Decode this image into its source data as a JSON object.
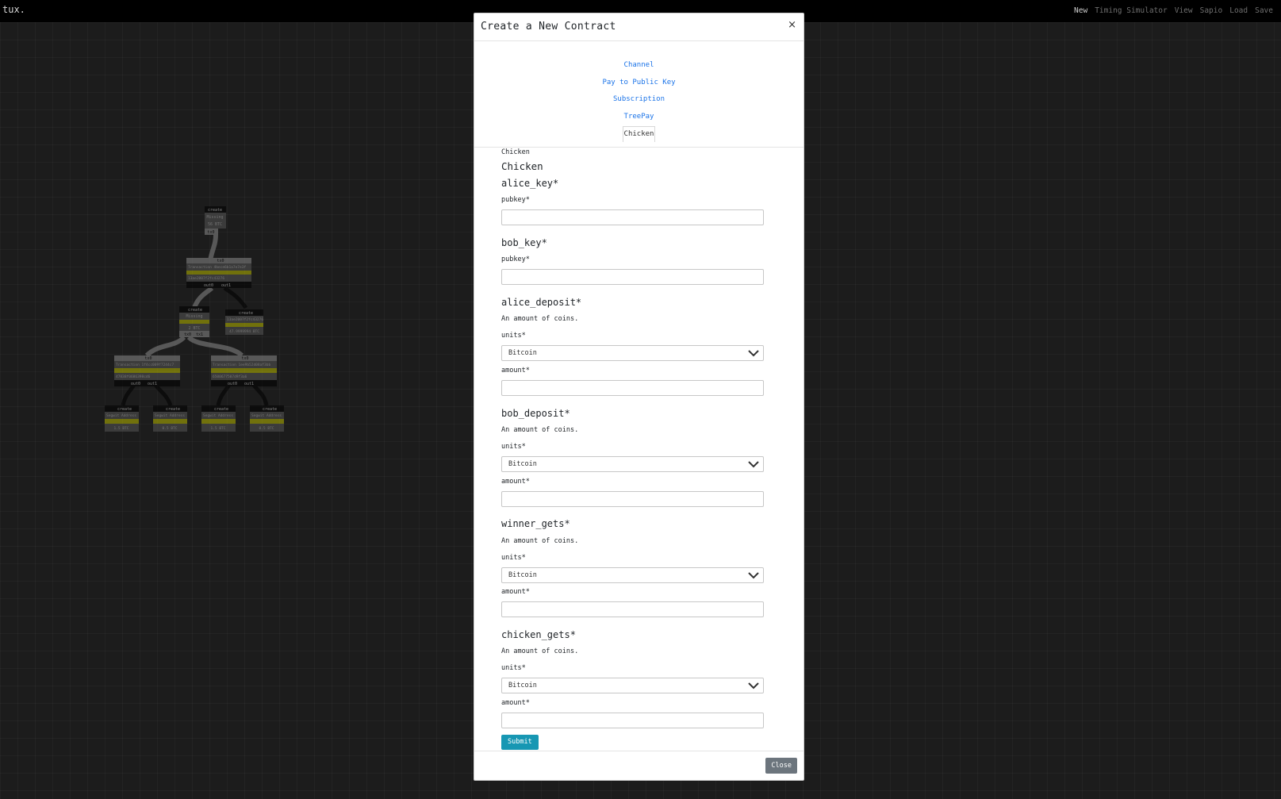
{
  "navbar": {
    "brand": "tux.",
    "links": [
      "New",
      "Timing Simulator",
      "View",
      "Sapio",
      "Load",
      "Save"
    ]
  },
  "modal": {
    "title": "Create a New Contract",
    "close_symbol": "×",
    "tabs": [
      "Channel",
      "Pay to Public Key",
      "Subscription",
      "TreePay",
      "Chicken"
    ],
    "active_tab": "Chicken",
    "form": {
      "breadcrumb": "Chicken",
      "title": "Chicken",
      "fields": {
        "alice_key": {
          "label": "alice_key*",
          "sub_label": "pubkey*",
          "value": ""
        },
        "bob_key": {
          "label": "bob_key*",
          "sub_label": "pubkey*",
          "value": ""
        },
        "alice_deposit": {
          "label": "alice_deposit*",
          "description": "An amount of coins.",
          "units_label": "units*",
          "units_value": "Bitcoin",
          "amount_label": "amount*",
          "amount_value": ""
        },
        "bob_deposit": {
          "label": "bob_deposit*",
          "description": "An amount of coins.",
          "units_label": "units*",
          "units_value": "Bitcoin",
          "amount_label": "amount*",
          "amount_value": ""
        },
        "winner_gets": {
          "label": "winner_gets*",
          "description": "An amount of coins.",
          "units_label": "units*",
          "units_value": "Bitcoin",
          "amount_label": "amount*",
          "amount_value": ""
        },
        "chicken_gets": {
          "label": "chicken_gets*",
          "description": "An amount of coins.",
          "units_label": "units*",
          "units_value": "Bitcoin",
          "amount_label": "amount*",
          "amount_value": ""
        }
      },
      "submit_label": "Submit"
    },
    "close_label": "Close"
  },
  "diagram": {
    "accent_yellow": "#b8b800",
    "node_dark": "#000000",
    "node_gray": "#8a8a8a",
    "root": {
      "header": "create",
      "line1": "Missing",
      "line2": "56 BTC",
      "port": "tx0"
    },
    "tx_top": {
      "header": "tx0",
      "line1": "Transaction 4bece6b1a7e7e3f",
      "line2": "13ae2007f2fc43276",
      "ports": [
        "out0",
        "out1"
      ]
    },
    "mid_left": {
      "header": "create",
      "line1": "Missing",
      "line2": "2 BTC",
      "ports": [
        "tx0",
        "tx1"
      ]
    },
    "mid_right": {
      "header": "create",
      "line1": "13ae2007f2fc43276",
      "line2": "47.9999994 BTC"
    },
    "tx_left": {
      "header": "tx0",
      "line1": "Transaction 1f4cc009f7244c7",
      "line2": "47838f0686398cd6",
      "ports": [
        "out0",
        "out1"
      ]
    },
    "tx_right": {
      "header": "tx0",
      "line1": "Transaction 1ee9b52d08af3bb",
      "line2": "6500677507d9f3a6",
      "ports": [
        "out0",
        "out1"
      ]
    },
    "leaves": [
      {
        "header": "create",
        "line1": "Segwit Address",
        "line2": "1.5 BTC"
      },
      {
        "header": "create",
        "line1": "Segwit Address",
        "line2": "0.5 BTC"
      },
      {
        "header": "create",
        "line1": "Segwit Address",
        "line2": "1.5 BTC"
      },
      {
        "header": "create",
        "line1": "Segwit Address",
        "line2": "0.5 BTC"
      }
    ]
  }
}
